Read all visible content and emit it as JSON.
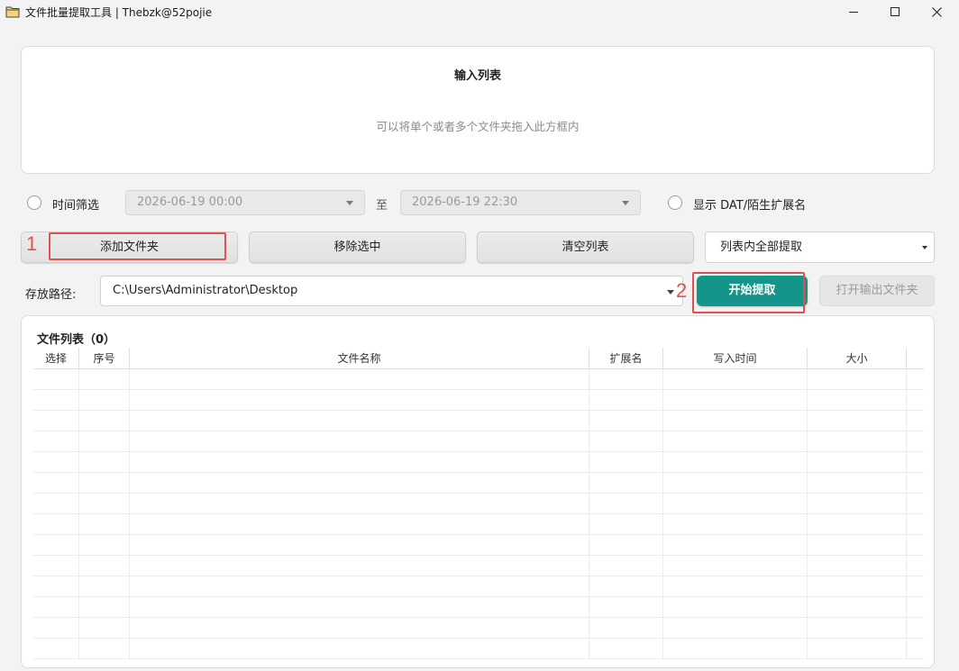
{
  "window": {
    "title": "文件批量提取工具 | Thebzk@52pojie"
  },
  "input_zone": {
    "title": "输入列表",
    "hint": "可以将单个或者多个文件夹拖入此方框内"
  },
  "filter": {
    "time_filter_label": "时间筛选",
    "start_time": "2026-06-19 00:00",
    "to_label": "至",
    "end_time": "2026-06-19 22:30",
    "show_ext_label": "显示 DAT/陌生扩展名"
  },
  "toolbar": {
    "add_folder": "添加文件夹",
    "remove_selected": "移除选中",
    "clear_list": "清空列表",
    "extract_mode": "列表内全部提取"
  },
  "output": {
    "path_label": "存放路径:",
    "path_value": "C:\\Users\\Administrator\\Desktop",
    "start_button": "开始提取",
    "open_button": "打开输出文件夹"
  },
  "annotations": [
    "1",
    "2"
  ],
  "file_list": {
    "title": "文件列表（0）",
    "columns": [
      "选择",
      "序号",
      "文件名称",
      "扩展名",
      "写入时间",
      "大小"
    ],
    "rows": []
  }
}
